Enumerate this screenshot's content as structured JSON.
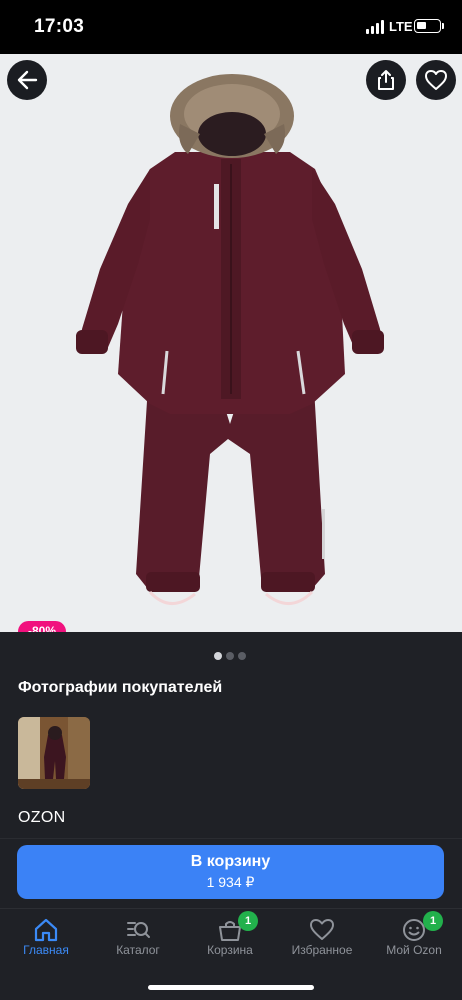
{
  "status_bar": {
    "time": "17:03",
    "network": "LTE",
    "icons": [
      "signal-icon",
      "battery-icon"
    ]
  },
  "product": {
    "discount": "-80%",
    "gallery": {
      "total_photos": 3,
      "active_index": 0
    },
    "image_icon": "snowsuit-image"
  },
  "header_icons": {
    "back": "back-arrow-icon",
    "share": "share-icon",
    "favorite": "heart-icon"
  },
  "customer_photos": {
    "title": "Фотографии покупателей"
  },
  "brand": "OZON",
  "cart": {
    "label": "В корзину",
    "price": "1 934 ₽",
    "accent": "#3b82f6"
  },
  "nav": {
    "accent": "#3b8af6",
    "badge_color": "#22b14c",
    "items": [
      {
        "label": "Главная",
        "icon": "home-icon",
        "active": true
      },
      {
        "label": "Каталог",
        "icon": "catalog-search-icon",
        "active": false
      },
      {
        "label": "Корзина",
        "icon": "cart-icon",
        "active": false,
        "badge": "1"
      },
      {
        "label": "Избранное",
        "icon": "heart-icon",
        "active": false
      },
      {
        "label": "Мой Ozon",
        "icon": "profile-icon",
        "active": false,
        "badge": "1"
      }
    ]
  }
}
